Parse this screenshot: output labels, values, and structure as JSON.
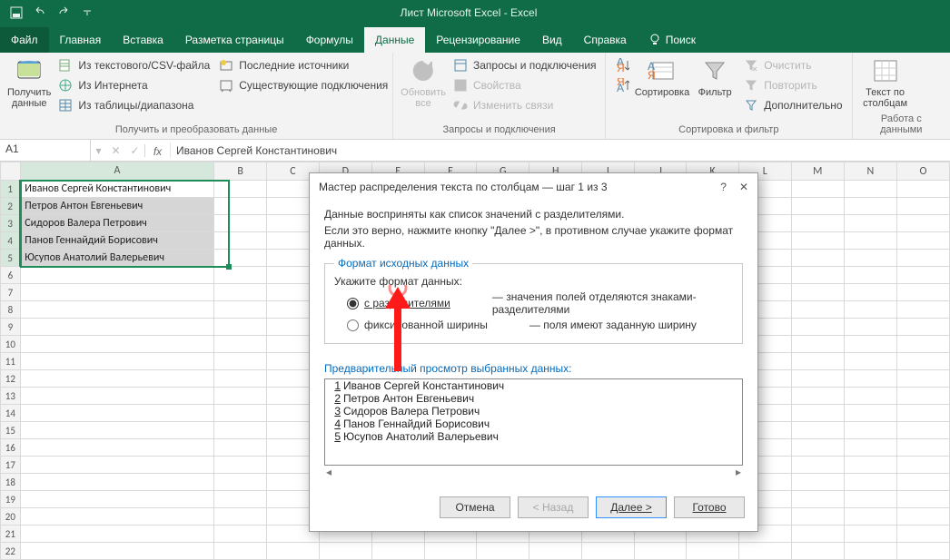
{
  "window": {
    "title": "Лист Microsoft Excel  -  Excel"
  },
  "tabs": {
    "file": "Файл",
    "items": [
      "Главная",
      "Вставка",
      "Разметка страницы",
      "Формулы",
      "Данные",
      "Рецензирование",
      "Вид",
      "Справка"
    ],
    "active": "Данные",
    "search": "Поиск"
  },
  "ribbon": {
    "g1": {
      "big": "Получить\nданные",
      "items": [
        "Из текстового/CSV-файла",
        "Из Интернета",
        "Из таблицы/диапазона",
        "Последние источники",
        "Существующие подключения"
      ],
      "label": "Получить и преобразовать данные"
    },
    "g2": {
      "big": "Обновить\nвсе",
      "items": [
        "Запросы и подключения",
        "Свойства",
        "Изменить связи"
      ],
      "label": "Запросы и подключения"
    },
    "g3": {
      "sort": "Сортировка",
      "filter": "Фильтр",
      "items": [
        "Очистить",
        "Повторить",
        "Дополнительно"
      ],
      "label": "Сортировка и фильтр"
    },
    "g4": {
      "big": "Текст по\nстолбцам",
      "label": "Работа с данными"
    }
  },
  "formula_bar": {
    "name_box": "A1",
    "fx": "fx",
    "value": "Иванов Сергей Константинович"
  },
  "grid": {
    "columns": [
      "A",
      "B",
      "C",
      "D",
      "E",
      "F",
      "G",
      "H",
      "I",
      "J",
      "K",
      "L",
      "M",
      "N",
      "O"
    ],
    "rows_shown": 22,
    "col_a": [
      "Иванов Сергей Константинович",
      "Петров Антон Евгеньевич",
      "Сидоров Валера Петрович",
      "Панов Геннайдий Борисович",
      "Юсупов Анатолий Валерьевич"
    ],
    "selection": "A1:A5"
  },
  "dialog": {
    "title": "Мастер распределения текста по столбцам — шаг 1 из 3",
    "intro1": "Данные восприняты как список значений с разделителями.",
    "intro2": "Если это верно, нажмите кнопку \"Далее >\", в противном случае укажите формат данных.",
    "fieldset_legend": "Формат исходных данных",
    "prompt": "Укажите формат данных:",
    "opt1_label": "с разделителями",
    "opt1_selected": true,
    "opt1_expl": "— значения полей отделяются знаками-разделителями",
    "opt2_label": "фиксированной ширины",
    "opt2_expl": "— поля имеют заданную ширину",
    "preview_label": "Предварительный просмотр выбранных данных:",
    "preview": [
      "Иванов Сергей Константинович",
      "Петров Антон Евгеньевич",
      "Сидоров Валера Петрович",
      "Панов Геннайдий Борисович",
      "Юсупов Анатолий Валерьевич"
    ],
    "buttons": {
      "cancel": "Отмена",
      "back": "< Назад",
      "next": "Далее >",
      "finish": "Готово"
    }
  }
}
